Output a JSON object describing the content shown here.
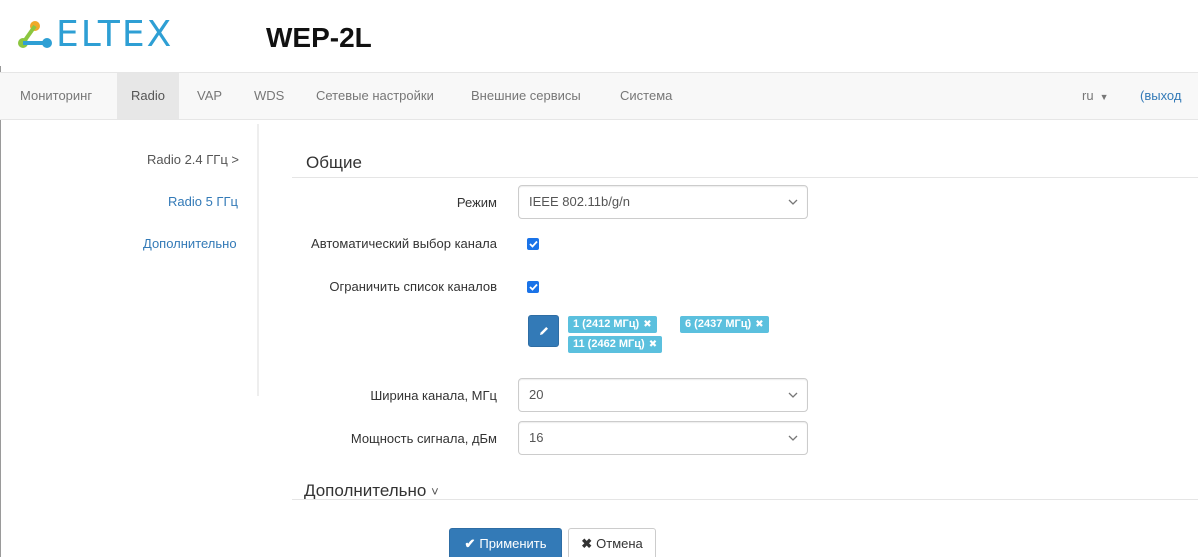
{
  "header": {
    "logo_text": "ELTEX",
    "model": "WEP-2L"
  },
  "nav": {
    "items": [
      {
        "label": "Мониторинг"
      },
      {
        "label": "Radio",
        "active": true
      },
      {
        "label": "VAP"
      },
      {
        "label": "WDS"
      },
      {
        "label": "Сетевые настройки"
      },
      {
        "label": "Внешние сервисы"
      },
      {
        "label": "Система"
      }
    ],
    "lang": "ru",
    "logout": "(выход"
  },
  "side": {
    "items": [
      {
        "label": "Radio 2.4 ГГц",
        "arrow": ">"
      },
      {
        "label": "Radio 5 ГГц"
      },
      {
        "label": "Дополнительно"
      }
    ]
  },
  "general": {
    "title": "Общие",
    "mode_label": "Режим",
    "mode_value": "IEEE 802.11b/g/n",
    "auto_channel_label": "Автоматический выбор канала",
    "auto_channel_checked": true,
    "limit_channels_label": "Ограничить список каналов",
    "limit_channels_checked": true,
    "channels": [
      "1 (2412 МГц)",
      "6 (2437 МГц)",
      "11 (2462 МГц)"
    ],
    "width_label": "Ширина канала, МГц",
    "width_value": "20",
    "power_label": "Мощность сигнала, дБм",
    "power_value": "16"
  },
  "advanced": {
    "title": "Дополнительно",
    "arrow": "˅"
  },
  "buttons": {
    "apply": "Применить",
    "cancel": "Отмена"
  },
  "colors": {
    "brand": "#2e9fd4",
    "link": "#337ab7",
    "primary": "#337ab7",
    "tag": "#5bc0de",
    "checkbox": "#1a73e8"
  }
}
